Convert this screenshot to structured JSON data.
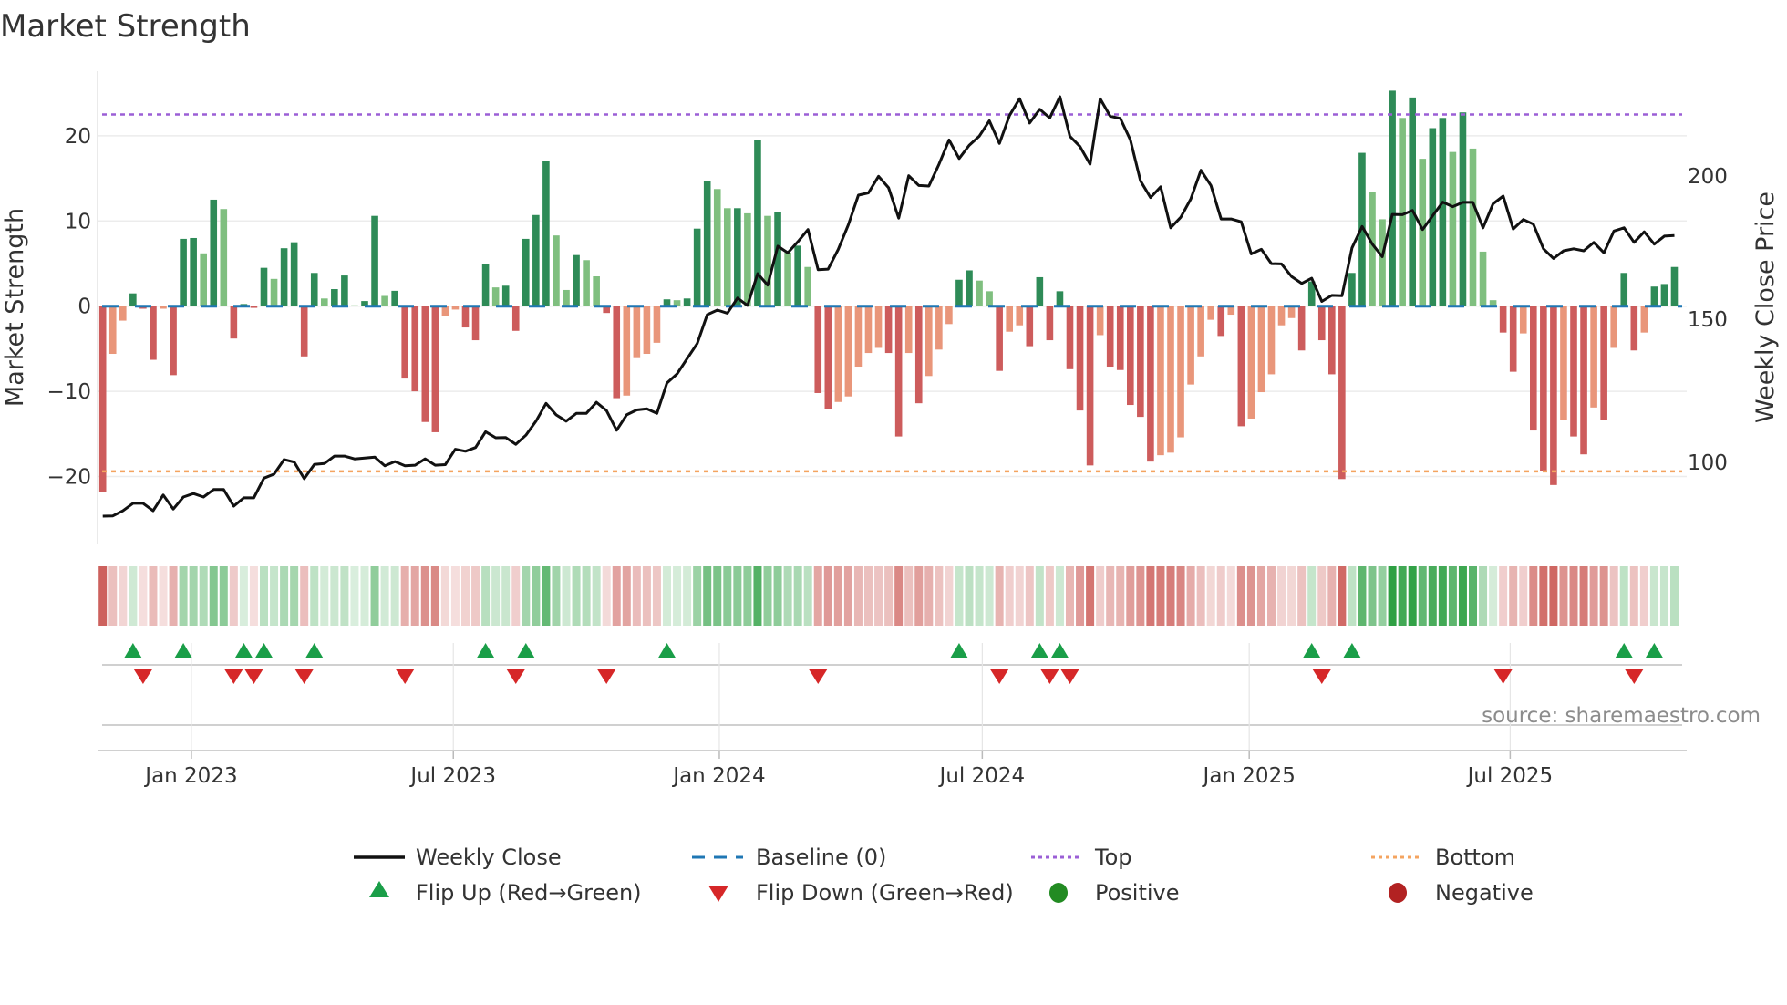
{
  "chart_data": {
    "type": "bar",
    "title": "Market Strength",
    "ylabel": "Market Strength",
    "y2label": "Weekly Close Price",
    "ylim": [
      -25.5,
      27.5
    ],
    "y2lim": [
      76,
      245
    ],
    "yticks": [
      20,
      10,
      0,
      -10,
      -20
    ],
    "yticklabels": [
      "20",
      "10",
      "0",
      "−10",
      "−20"
    ],
    "y2ticks": [
      200,
      150,
      100
    ],
    "y2ticklabels": [
      "200",
      "150",
      "100"
    ],
    "top_level": 22.5,
    "bottom_level": -19.4,
    "baseline": 0,
    "xticks": [
      {
        "x": 8.8,
        "label": "Jan 2023"
      },
      {
        "x": 34.8,
        "label": "Jul 2023"
      },
      {
        "x": 61.2,
        "label": "Jan 2024"
      },
      {
        "x": 87.3,
        "label": "Jul 2024"
      },
      {
        "x": 113.8,
        "label": "Jan 2025"
      },
      {
        "x": 139.7,
        "label": "Jul 2025"
      }
    ],
    "x_unit": "week index",
    "strength": [
      -21.8,
      -5.6,
      -1.7,
      1.5,
      -0.3,
      -6.3,
      -0.3,
      -8.1,
      7.9,
      8.0,
      6.2,
      12.5,
      11.4,
      -3.8,
      0.25,
      -0.2,
      4.5,
      3.2,
      6.8,
      7.5,
      -5.9,
      3.9,
      0.9,
      2.0,
      3.6,
      0.1,
      0.6,
      10.6,
      1.2,
      1.8,
      -8.5,
      -10.0,
      -13.6,
      -14.8,
      -1.2,
      -0.4,
      -2.5,
      -4.0,
      4.9,
      2.2,
      2.4,
      -2.9,
      7.9,
      10.7,
      17.0,
      8.3,
      1.9,
      6.0,
      5.4,
      3.5,
      -0.8,
      -10.8,
      -10.5,
      -6.1,
      -5.6,
      -4.3,
      0.8,
      0.7,
      0.9,
      9.1,
      14.7,
      13.75,
      11.5,
      11.5,
      10.9,
      19.5,
      10.6,
      11.0,
      6.3,
      7.1,
      4.6,
      -10.2,
      -12.1,
      -11.25,
      -10.6,
      -7.1,
      -5.5,
      -4.9,
      -5.5,
      -15.3,
      -5.5,
      -11.4,
      -8.2,
      -5.1,
      -2.1,
      3.1,
      4.2,
      3.0,
      1.75,
      -7.6,
      -3.0,
      -2.25,
      -4.7,
      3.4,
      -4.0,
      1.75,
      -7.4,
      -12.25,
      -18.7,
      -3.4,
      -7.1,
      -7.5,
      -11.6,
      -13.0,
      -18.25,
      -17.5,
      -17.2,
      -15.4,
      -9.2,
      -5.9,
      -1.6,
      -3.5,
      -1.0,
      -14.1,
      -13.2,
      -10.1,
      -8.0,
      -2.25,
      -1.4,
      -5.2,
      2.9,
      -4.0,
      -8.0,
      -20.3,
      3.9,
      18.0,
      13.4,
      10.2,
      25.3,
      22.1,
      24.5,
      17.3,
      20.9,
      22.1,
      18.1,
      22.75,
      18.5,
      6.4,
      0.7,
      -3.1,
      -7.7,
      -3.2,
      -14.6,
      -19.4,
      -21.0,
      -13.4,
      -15.3,
      -17.4,
      -11.9,
      -13.4,
      -4.9,
      3.9,
      -5.2,
      -3.1,
      2.3,
      2.6,
      4.6
    ],
    "weekly_close": [
      81.2,
      81.3,
      83.1,
      85.7,
      85.7,
      83.1,
      88.6,
      83.7,
      87.9,
      89.1,
      87.9,
      90.5,
      90.5,
      84.7,
      87.6,
      87.6,
      94.5,
      95.9,
      101,
      100.1,
      94.3,
      99.3,
      99.6,
      102.2,
      102.2,
      101.2,
      101.5,
      101.8,
      98.8,
      100.3,
      98.8,
      99,
      101.2,
      99,
      99.2,
      104.6,
      103.9,
      105.2,
      110.7,
      108.6,
      108.7,
      106.3,
      109.5,
      114.4,
      120.6,
      116.6,
      114.4,
      117.1,
      117.1,
      121,
      118.1,
      111.2,
      116.6,
      118.3,
      118.7,
      117.1,
      127.7,
      130.9,
      136.2,
      141.5,
      151.6,
      153.2,
      152.1,
      157.4,
      154.8,
      165.9,
      161.9,
      175.5,
      173.2,
      177.1,
      181.3,
      167.3,
      167.5,
      174.4,
      182.9,
      193.3,
      194.1,
      199.9,
      195.9,
      185.3,
      200.1,
      196.7,
      196.5,
      204.1,
      212.6,
      206.1,
      210.7,
      213.9,
      219.3,
      211.4,
      221.1,
      227,
      218.5,
      223.3,
      220.3,
      227.7,
      213.9,
      210.3,
      204.1,
      227,
      220.9,
      220.1,
      212.6,
      198.3,
      192.5,
      196.2,
      181.9,
      185.6,
      192,
      202,
      196.7,
      185,
      185,
      184,
      172.8,
      174.4,
      169.4,
      169.3,
      164.9,
      162.5,
      164.3,
      156.2,
      158.3,
      158.2,
      174.9,
      182.4,
      176.3,
      171.8,
      186.6,
      186.5,
      188,
      181.3,
      186.1,
      190.9,
      189.3,
      190.8,
      190.8,
      181.9,
      190.3,
      193,
      181.5,
      184.8,
      183.2,
      174.6,
      171.2,
      173.9,
      174.6,
      173.9,
      176.8,
      173.2,
      180.8,
      181.9,
      176.8,
      180.5,
      176.2,
      179,
      179.2
    ],
    "legend": {
      "placement": "bottom",
      "items": [
        {
          "label": "Weekly Close",
          "symbol": "line-solid"
        },
        {
          "label": "Baseline (0)",
          "symbol": "line-dashed"
        },
        {
          "label": "Top",
          "symbol": "line-dotted"
        },
        {
          "label": "Bottom",
          "symbol": "line-dotted"
        },
        {
          "label": "Flip Up (Red→Green)",
          "symbol": "triangle-up"
        },
        {
          "label": "Flip Down (Green→Red)",
          "symbol": "triangle-down"
        },
        {
          "label": "Positive",
          "symbol": "circle"
        },
        {
          "label": "Negative",
          "symbol": "circle"
        }
      ]
    },
    "grid": true
  },
  "source": "source: sharemaestro.com",
  "colors": {
    "pos_strong": "#2e8b57",
    "pos_weak": "#7fbf7f",
    "neg_strong": "#cd5c5c",
    "neg_weak": "#e9967a",
    "line": "#111111",
    "baseline": "#1f77b4",
    "top": "#9b5fd6",
    "bottom": "#f4a460",
    "flip_up": "#1a9e48",
    "flip_down": "#d62728",
    "positive": "#228b22",
    "negative": "#b22222"
  }
}
